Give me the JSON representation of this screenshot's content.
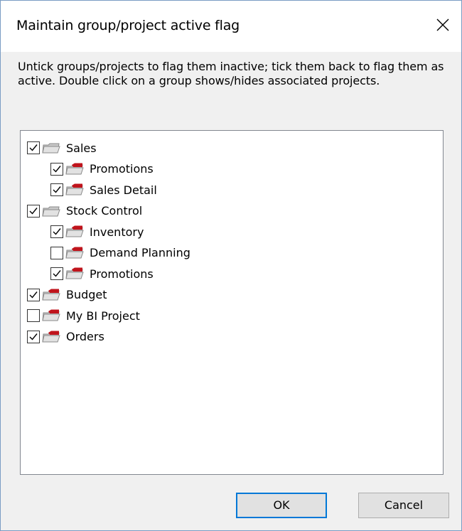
{
  "dialog": {
    "title": "Maintain group/project active flag",
    "description": "Untick groups/projects to flag them inactive; tick them back to flag them as active. Double click on a group shows/hides associated projects.",
    "ok_label": "OK",
    "cancel_label": "Cancel"
  },
  "tree": {
    "items": [
      {
        "label": "Sales",
        "level": 0,
        "checked": true,
        "kind": "group"
      },
      {
        "label": "Promotions",
        "level": 1,
        "checked": true,
        "kind": "project"
      },
      {
        "label": "Sales Detail",
        "level": 1,
        "checked": true,
        "kind": "project"
      },
      {
        "label": "Stock Control",
        "level": 0,
        "checked": true,
        "kind": "group"
      },
      {
        "label": "Inventory",
        "level": 1,
        "checked": true,
        "kind": "project"
      },
      {
        "label": "Demand Planning",
        "level": 1,
        "checked": false,
        "kind": "project"
      },
      {
        "label": "Promotions",
        "level": 1,
        "checked": true,
        "kind": "project"
      },
      {
        "label": "Budget",
        "level": 0,
        "checked": true,
        "kind": "project"
      },
      {
        "label": "My BI Project",
        "level": 0,
        "checked": false,
        "kind": "project"
      },
      {
        "label": "Orders",
        "level": 0,
        "checked": true,
        "kind": "project"
      }
    ]
  },
  "colors": {
    "folder_body": "#c8c8c8",
    "folder_edge": "#8a8a8a",
    "project_flag": "#c0141c",
    "accent": "#0078d7"
  },
  "icons": {
    "close": "close-icon",
    "group_folder": "folder-icon",
    "project_folder": "project-folder-icon",
    "check": "check-icon"
  }
}
